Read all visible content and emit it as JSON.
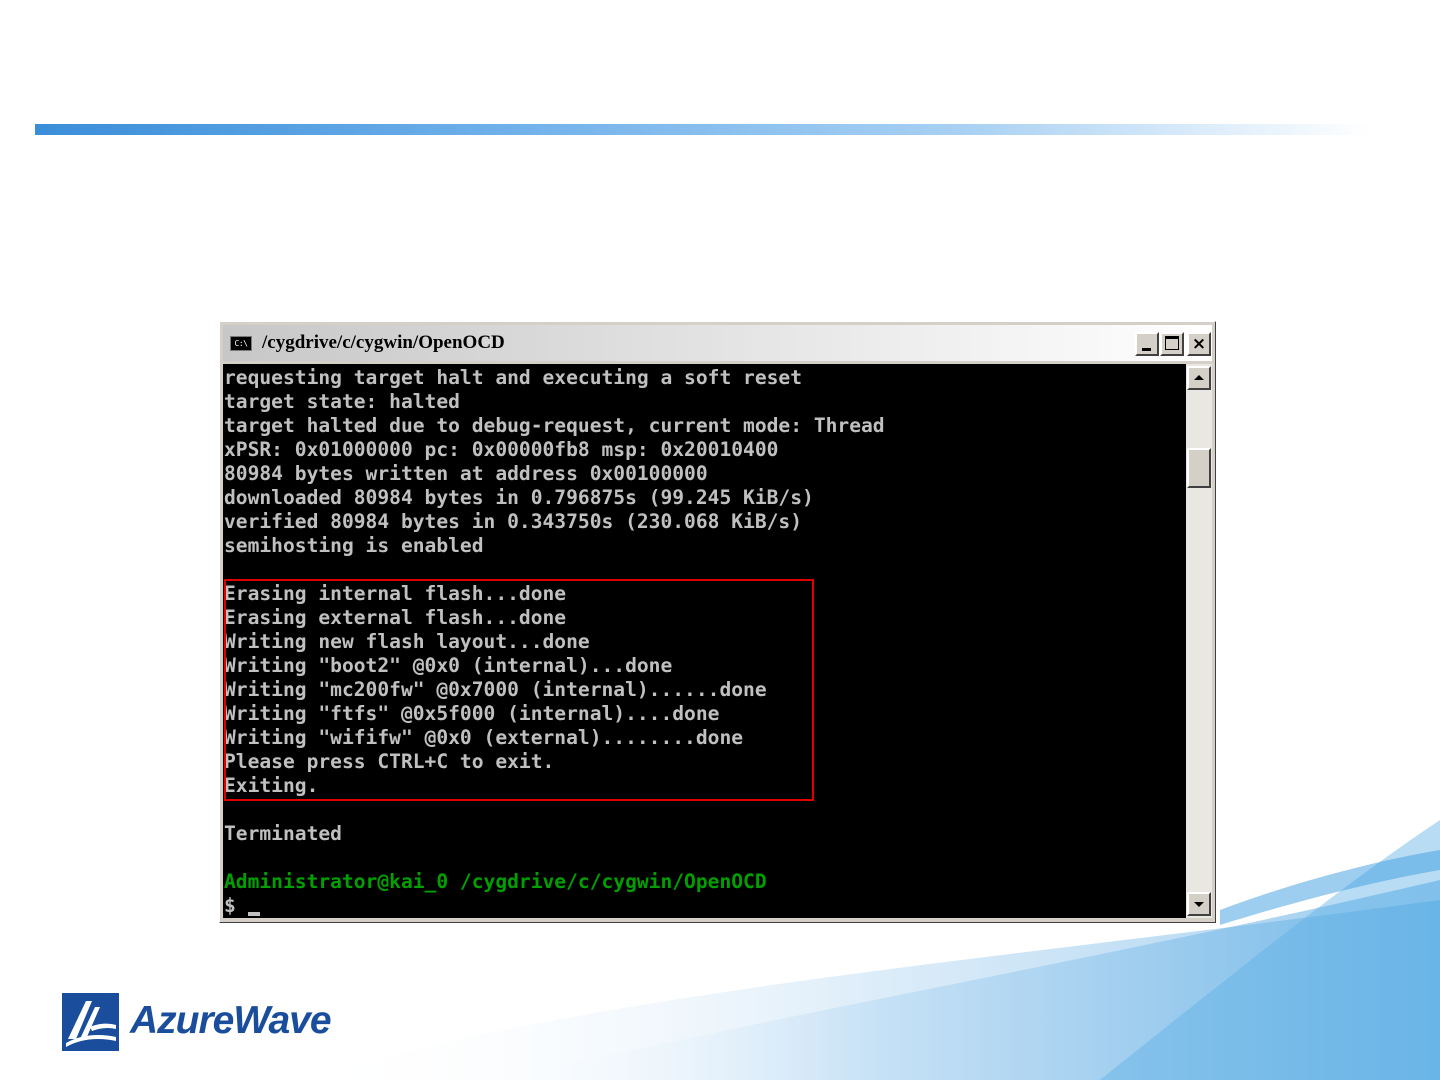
{
  "window": {
    "title": "/cygdrive/c/cygwin/OpenOCD",
    "icon_label": "C:\\",
    "icon": "console-icon",
    "controls": {
      "minimize": "minimize-icon",
      "maximize": "maximize-icon",
      "close_label": "×"
    }
  },
  "console": {
    "lines": [
      "requesting target halt and executing a soft reset",
      "target state: halted",
      "target halted due to debug-request, current mode: Thread",
      "xPSR: 0x01000000 pc: 0x00000fb8 msp: 0x20010400",
      "80984 bytes written at address 0x00100000",
      "downloaded 80984 bytes in 0.796875s (99.245 KiB/s)",
      "verified 80984 bytes in 0.343750s (230.068 KiB/s)",
      "semihosting is enabled",
      "",
      "Erasing internal flash...done",
      "Erasing external flash...done",
      "Writing new flash layout...done",
      "Writing \"boot2\" @0x0 (internal)...done",
      "Writing \"mc200fw\" @0x7000 (internal)......done",
      "Writing \"ftfs\" @0x5f000 (internal)....done",
      "Writing \"wififw\" @0x0 (external)........done",
      "Please press CTRL+C to exit.",
      "Exiting.",
      "",
      "Terminated",
      "",
      "Administrator@kai_0 /cygdrive/c/cygwin/OpenOCD"
    ],
    "prompt": "$ ",
    "colors": {
      "background": "#000000",
      "text": "#c0c0c0",
      "prompt_user": "#00a000",
      "highlight_border": "#e00000"
    }
  },
  "logo": {
    "text": "AzureWave",
    "color": "#1a4e9c"
  }
}
